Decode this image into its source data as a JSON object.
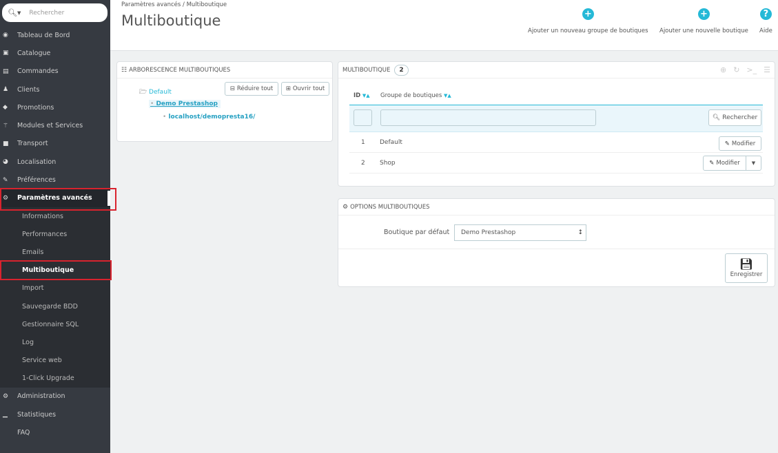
{
  "search": {
    "placeholder": "Rechercher"
  },
  "menu": {
    "items": [
      {
        "label": "Tableau de Bord",
        "icon": "dashboard-icon"
      },
      {
        "label": "Catalogue",
        "icon": "catalog-icon"
      },
      {
        "label": "Commandes",
        "icon": "orders-icon"
      },
      {
        "label": "Clients",
        "icon": "customers-icon"
      },
      {
        "label": "Promotions",
        "icon": "promotions-icon"
      },
      {
        "label": "Modules et Services",
        "icon": "modules-icon"
      },
      {
        "label": "Transport",
        "icon": "transport-icon"
      },
      {
        "label": "Localisation",
        "icon": "localization-icon"
      },
      {
        "label": "Préférences",
        "icon": "preferences-icon"
      },
      {
        "label": "Paramètres avancés",
        "icon": "gears-icon"
      }
    ],
    "submenu": [
      "Informations",
      "Performances",
      "Emails",
      "Multiboutique",
      "Import",
      "Sauvegarde BDD",
      "Gestionnaire SQL",
      "Log",
      "Service web",
      "1-Click Upgrade"
    ],
    "bottom_items": [
      {
        "label": "Administration",
        "icon": "admin-icon"
      },
      {
        "label": "Statistiques",
        "icon": "stats-icon"
      },
      {
        "label": "FAQ",
        "icon": "faq-icon"
      }
    ]
  },
  "header": {
    "breadcrumb": "Paramètres avancés  /  Multiboutique",
    "title": "Multiboutique",
    "add_group": "Ajouter un nouveau groupe de boutiques",
    "add_shop": "Ajouter une nouvelle boutique",
    "help": "Aide"
  },
  "tree_panel": {
    "heading": "ARBORESCENCE MULTIBOUTIQUES",
    "collapse": "Réduire tout",
    "expand": "Ouvrir tout",
    "node_group": "Default",
    "node_shop": "Demo Prestashop",
    "node_url": "localhost/demopresta16/"
  },
  "list_panel": {
    "heading": "MULTIBOUTIQUE",
    "count": "2",
    "col_id": "ID",
    "col_group": "Groupe de boutiques",
    "search_button": "Rechercher",
    "rows": [
      {
        "id": "1",
        "name": "Default",
        "action": "Modifier"
      },
      {
        "id": "2",
        "name": "Shop",
        "action": "Modifier"
      }
    ]
  },
  "options_panel": {
    "heading": "OPTIONS MULTIBOUTIQUES",
    "default_shop_label": "Boutique par défaut",
    "default_shop_value": "Demo Prestashop",
    "save": "Enregistrer"
  },
  "colors": {
    "accent": "#25b9d7",
    "sidebar": "#363a41",
    "highlight": "#d9232e"
  }
}
